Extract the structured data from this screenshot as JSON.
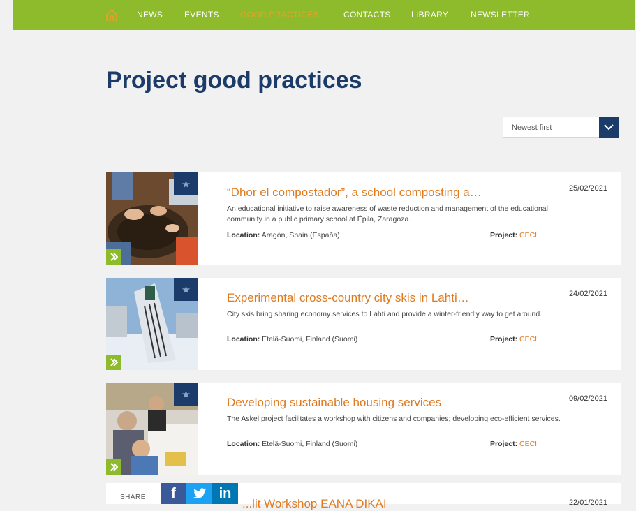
{
  "nav": {
    "items": [
      {
        "label": "NEWS"
      },
      {
        "label": "EVENTS"
      },
      {
        "label": "GOOD PRACTICES"
      },
      {
        "label": "CONTACTS"
      },
      {
        "label": "LIBRARY"
      },
      {
        "label": "NEWSLETTER"
      }
    ],
    "active": "GOOD PRACTICES"
  },
  "page": {
    "title": "Project good practices"
  },
  "sort": {
    "selected": "Newest first"
  },
  "practices": [
    {
      "title": "“Dhor el compostador”, a school composting a…",
      "date": "25/02/2021",
      "description": "An educational initiative to raise awareness of waste reduction and management of the educational community in a public primary school at Épila, Zaragoza.",
      "location_label": "Location:",
      "location": "Aragón, Spain (España)",
      "project_label": "Project:",
      "project": "CECI"
    },
    {
      "title": "Experimental cross-country city skis in Lahti…",
      "date": "24/02/2021",
      "description": "City skis bring sharing economy services to Lahti and provide a winter-friendly way to get around.",
      "location_label": "Location:",
      "location": "Etelä-Suomi, Finland (Suomi)",
      "project_label": "Project:",
      "project": "CECI"
    },
    {
      "title": "Developing sustainable housing services",
      "date": "09/02/2021",
      "description": "The Askel project facilitates a workshop with citizens and companies; developing eco-efficient services.",
      "location_label": "Location:",
      "location": "Etelä-Suomi, Finland (Suomi)",
      "project_label": "Project:",
      "project": "CECI"
    }
  ],
  "partial": {
    "title": "...lit Workshop EANA DIKAI",
    "date": "22/01/2021"
  },
  "share": {
    "label": "SHARE",
    "buttons": [
      {
        "network": "facebook",
        "glyph": "f",
        "color": "#3b5998"
      },
      {
        "network": "twitter",
        "glyph": "t",
        "color": "#1da1f2"
      },
      {
        "network": "linkedin",
        "glyph": "in",
        "color": "#0077b5"
      }
    ]
  },
  "colors": {
    "nav_green": "#8dbb2b",
    "title_navy": "#1b3c6a",
    "link_orange": "#e07a1f"
  }
}
